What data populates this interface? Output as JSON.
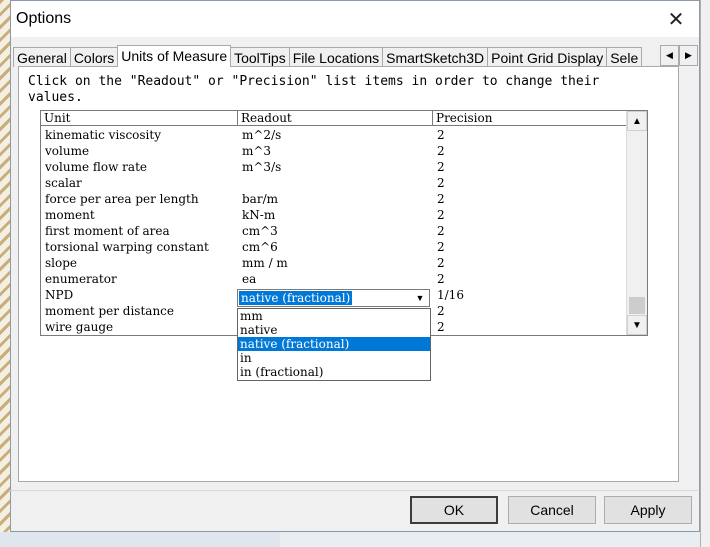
{
  "window": {
    "title": "Options",
    "close_glyph": "✕"
  },
  "tabs": [
    {
      "label": "General"
    },
    {
      "label": "Colors"
    },
    {
      "label": "Units of Measure"
    },
    {
      "label": "ToolTips"
    },
    {
      "label": "File Locations"
    },
    {
      "label": "SmartSketch3D"
    },
    {
      "label": "Point Grid Display"
    },
    {
      "label": "Sele"
    }
  ],
  "active_tab": "Units of Measure",
  "tab_scroll": {
    "left_glyph": "◀",
    "right_glyph": "▶"
  },
  "instruction": "Click on the \"Readout\" or \"Precision\" list items in order to change their values.",
  "grid": {
    "columns": [
      "Unit",
      "Readout",
      "Precision"
    ],
    "rows": [
      {
        "unit": "kinematic viscosity",
        "readout": "m^2/s",
        "precision": "2"
      },
      {
        "unit": "volume",
        "readout": "m^3",
        "precision": "2"
      },
      {
        "unit": "volume flow rate",
        "readout": "m^3/s",
        "precision": "2"
      },
      {
        "unit": "scalar",
        "readout": "",
        "precision": "2"
      },
      {
        "unit": "force per area per length",
        "readout": "bar/m",
        "precision": "2"
      },
      {
        "unit": "moment",
        "readout": "kN-m",
        "precision": "2"
      },
      {
        "unit": "first moment of area",
        "readout": "cm^3",
        "precision": "2"
      },
      {
        "unit": "torsional warping constant",
        "readout": "cm^6",
        "precision": "2"
      },
      {
        "unit": "slope",
        "readout": "mm / m",
        "precision": "2"
      },
      {
        "unit": "enumerator",
        "readout": "ea",
        "precision": "2"
      },
      {
        "unit": "NPD",
        "readout": "",
        "precision": "1/16"
      },
      {
        "unit": "moment per distance",
        "readout": "",
        "precision": "2"
      },
      {
        "unit": "wire gauge",
        "readout": "",
        "precision": "2"
      }
    ],
    "scroll_up_glyph": "▲",
    "scroll_down_glyph": "▼"
  },
  "combo": {
    "value": "native (fractional)",
    "arrow_glyph": "▼",
    "options": [
      "mm",
      "native",
      "native (fractional)",
      "in",
      "in (fractional)"
    ],
    "selected_index": 2
  },
  "buttons": {
    "ok": "OK",
    "cancel": "Cancel",
    "apply": "Apply"
  },
  "colors": {
    "selection": "#0078d7",
    "window_bg": "#f0f0f0"
  }
}
